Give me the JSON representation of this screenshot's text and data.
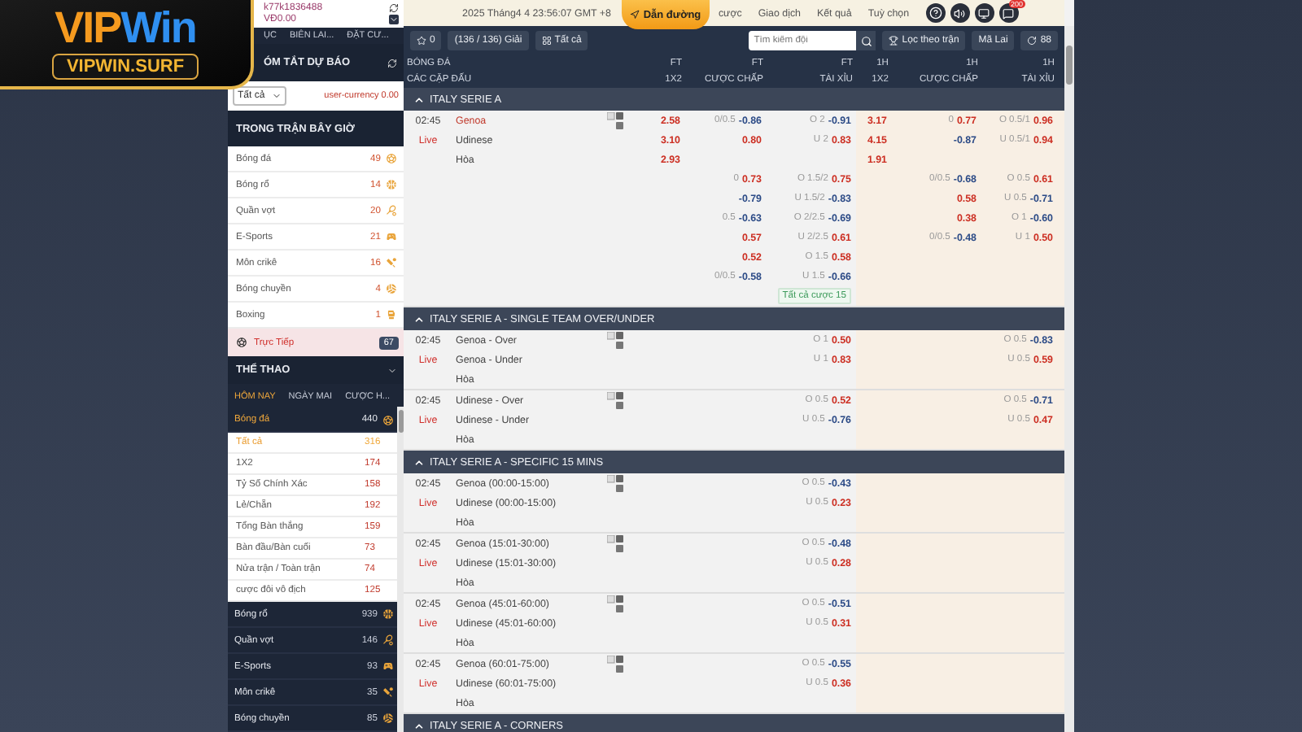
{
  "logo": {
    "wordmark": [
      "VIP",
      "Win"
    ],
    "domain": "VIPWIN.SURF"
  },
  "sidebar": {
    "account": {
      "username": "k77k1836488",
      "balance": "VĐ0.00"
    },
    "nav": [
      "ỤC",
      "BIÊN LAI...",
      "ĐẶT CƯ..."
    ],
    "summary": {
      "title": "ÓM TẮT DỰ BÁO",
      "filter": "Tất cả",
      "currency": "user-currency 0.00"
    },
    "in_play": {
      "title": "TRONG TRẬN BÂY GIỜ",
      "items": [
        {
          "name": "Bóng đá",
          "count": "49",
          "kind": "football"
        },
        {
          "name": "Bóng rổ",
          "count": "14",
          "kind": "basketball"
        },
        {
          "name": "Quần vợt",
          "count": "20",
          "kind": "tennis"
        },
        {
          "name": "E-Sports",
          "count": "21",
          "kind": "esports"
        },
        {
          "name": "Môn crikê",
          "count": "16",
          "kind": "cricket"
        },
        {
          "name": "Bóng chuyền",
          "count": "4",
          "kind": "volleyball"
        },
        {
          "name": "Boxing",
          "count": "1",
          "kind": "boxing"
        }
      ],
      "live": {
        "label": "Trực Tiếp",
        "count": "67"
      }
    },
    "sports": {
      "title": "THỂ THAO",
      "tabs": [
        {
          "label": "HÔM NAY",
          "selected": true
        },
        {
          "label": "NGÀY MAI",
          "selected": false
        },
        {
          "label": "CƯỢC H...",
          "selected": false
        }
      ],
      "featured": {
        "name": "Bóng đá",
        "count": "440",
        "kind": "football"
      },
      "markets": [
        {
          "name": "Tất cả",
          "count": "316",
          "selected": true
        },
        {
          "name": "1X2",
          "count": "174",
          "selected": false
        },
        {
          "name": "Tỷ Số Chính Xác",
          "count": "158",
          "selected": false
        },
        {
          "name": "Lẻ/Chẵn",
          "count": "192",
          "selected": false
        },
        {
          "name": "Tổng Bàn thắng",
          "count": "159",
          "selected": false
        },
        {
          "name": "Bàn đầu/Bàn cuối",
          "count": "73",
          "selected": false
        },
        {
          "name": "Nửa trận / Toàn trận",
          "count": "74",
          "selected": false
        },
        {
          "name": "cược đôi vô địch",
          "count": "125",
          "selected": false
        }
      ],
      "others": [
        {
          "name": "Bóng rổ",
          "count": "939",
          "kind": "basketball"
        },
        {
          "name": "Quần vợt",
          "count": "146",
          "kind": "tennis"
        },
        {
          "name": "E-Sports",
          "count": "93",
          "kind": "esports"
        },
        {
          "name": "Môn crikê",
          "count": "35",
          "kind": "cricket"
        },
        {
          "name": "Bóng chuyền",
          "count": "85",
          "kind": "volleyball"
        }
      ]
    }
  },
  "main": {
    "header": {
      "datetime": "2025 Tháng4 4 23:56:07 GMT +8",
      "guide": "Dẫn đường",
      "nav": [
        "cược",
        "Giao dịch",
        "Kết quả",
        "Tuỳ chọn"
      ],
      "badge": "200"
    },
    "toolbar": {
      "favorites": "0",
      "leagues": "(136 / 136) Giải",
      "all": "Tất cả",
      "search_placeholder": "Tìm kiếm đội",
      "filter": "Lọc theo trận",
      "odds_type": "Mã Lai",
      "refresh": "88"
    },
    "columns": [
      {
        "top": "BÓNG ĐÁ",
        "bottom": "CÁC CẶP ĐẤU"
      },
      {
        "top": "FT",
        "bottom": "1X2"
      },
      {
        "top": "FT",
        "bottom": "CƯỢC CHẤP"
      },
      {
        "top": "FT",
        "bottom": "TÀI XỈU"
      },
      {
        "top": "1H",
        "bottom": "1X2"
      },
      {
        "top": "1H",
        "bottom": "CƯỢC CHẤP"
      },
      {
        "top": "1H",
        "bottom": "TÀI XỈU"
      }
    ],
    "leagues": [
      {
        "name": "ITALY SERIE A",
        "expanded": true,
        "matches": [
          {
            "time": "02:45",
            "status": "Live",
            "more_bets": "Tất cả cược 15",
            "rows": [
              {
                "team": "Genoa",
                "favorite": true,
                "cells": [
                  {
                    "odds": "2.58",
                    "negative": false
                  },
                  {
                    "line": "0/0.5",
                    "odds": "-0.86",
                    "negative": true
                  },
                  {
                    "line": "O 2",
                    "odds": "-0.91",
                    "negative": true
                  },
                  {
                    "odds": "3.17",
                    "negative": false
                  },
                  {
                    "line": "0",
                    "odds": "0.77",
                    "negative": false
                  },
                  {
                    "line": "O 0.5/1",
                    "odds": "0.96",
                    "negative": false
                  }
                ]
              },
              {
                "team": "Udinese",
                "favorite": false,
                "cells": [
                  {
                    "odds": "3.10",
                    "negative": false
                  },
                  {
                    "odds": "0.80",
                    "negative": false
                  },
                  {
                    "line": "U 2",
                    "odds": "0.83",
                    "negative": false
                  },
                  {
                    "odds": "4.15",
                    "negative": false
                  },
                  {
                    "odds": "-0.87",
                    "negative": true
                  },
                  {
                    "line": "U 0.5/1",
                    "odds": "0.94",
                    "negative": false
                  }
                ]
              },
              {
                "team": "Hòa",
                "favorite": false,
                "cells": [
                  {
                    "odds": "2.93",
                    "negative": false
                  },
                  null,
                  null,
                  {
                    "odds": "1.91",
                    "negative": false
                  },
                  null,
                  null
                ]
              },
              {
                "cells": [
                  null,
                  {
                    "line": "0",
                    "odds": "0.73",
                    "negative": false
                  },
                  {
                    "line": "O 1.5/2",
                    "odds": "0.75",
                    "negative": false
                  },
                  null,
                  {
                    "line": "0/0.5",
                    "odds": "-0.68",
                    "negative": true
                  },
                  {
                    "line": "O 0.5",
                    "odds": "0.61",
                    "negative": false
                  }
                ]
              },
              {
                "cells": [
                  null,
                  {
                    "odds": "-0.79",
                    "negative": true
                  },
                  {
                    "line": "U 1.5/2",
                    "odds": "-0.83",
                    "negative": true
                  },
                  null,
                  {
                    "odds": "0.58",
                    "negative": false
                  },
                  {
                    "line": "U 0.5",
                    "odds": "-0.71",
                    "negative": true
                  }
                ]
              },
              {
                "cells": [
                  null,
                  {
                    "line": "0.5",
                    "odds": "-0.63",
                    "negative": true
                  },
                  {
                    "line": "O 2/2.5",
                    "odds": "-0.69",
                    "negative": true
                  },
                  null,
                  {
                    "odds": "0.38",
                    "negative": false
                  },
                  {
                    "line": "O 1",
                    "odds": "-0.60",
                    "negative": true
                  }
                ]
              },
              {
                "cells": [
                  null,
                  {
                    "odds": "0.57",
                    "negative": false
                  },
                  {
                    "line": "U 2/2.5",
                    "odds": "0.61",
                    "negative": false
                  },
                  null,
                  {
                    "line": "0/0.5",
                    "odds": "-0.48",
                    "negative": true
                  },
                  {
                    "line": "U 1",
                    "odds": "0.50",
                    "negative": false
                  }
                ]
              },
              {
                "cells": [
                  null,
                  {
                    "odds": "0.52",
                    "negative": false
                  },
                  {
                    "line": "O 1.5",
                    "odds": "0.58",
                    "negative": false
                  },
                  null,
                  null,
                  null
                ]
              },
              {
                "cells": [
                  null,
                  {
                    "line": "0/0.5",
                    "odds": "-0.58",
                    "negative": true
                  },
                  {
                    "line": "U 1.5",
                    "odds": "-0.66",
                    "negative": true
                  },
                  null,
                  null,
                  null
                ]
              }
            ]
          }
        ]
      },
      {
        "name": "ITALY SERIE A - SINGLE TEAM OVER/UNDER",
        "expanded": true,
        "matches": [
          {
            "time": "02:45",
            "status": "Live",
            "rows": [
              {
                "team": "Genoa - Over",
                "favorite": false,
                "cells": [
                  null,
                  null,
                  {
                    "line": "O 1",
                    "odds": "0.50",
                    "negative": false
                  },
                  null,
                  null,
                  {
                    "line": "O 0.5",
                    "odds": "-0.83",
                    "negative": true
                  }
                ]
              },
              {
                "team": "Genoa - Under",
                "favorite": false,
                "cells": [
                  null,
                  null,
                  {
                    "line": "U 1",
                    "odds": "0.83",
                    "negative": false
                  },
                  null,
                  null,
                  {
                    "line": "U 0.5",
                    "odds": "0.59",
                    "negative": false
                  }
                ]
              },
              {
                "team": "Hòa",
                "favorite": false,
                "cells": [
                  null,
                  null,
                  null,
                  null,
                  null,
                  null
                ]
              }
            ]
          },
          {
            "time": "02:45",
            "status": "Live",
            "rows": [
              {
                "team": "Udinese - Over",
                "favorite": false,
                "cells": [
                  null,
                  null,
                  {
                    "line": "O 0.5",
                    "odds": "0.52",
                    "negative": false
                  },
                  null,
                  null,
                  {
                    "line": "O 0.5",
                    "odds": "-0.71",
                    "negative": true
                  }
                ]
              },
              {
                "team": "Udinese - Under",
                "favorite": false,
                "cells": [
                  null,
                  null,
                  {
                    "line": "U 0.5",
                    "odds": "-0.76",
                    "negative": true
                  },
                  null,
                  null,
                  {
                    "line": "U 0.5",
                    "odds": "0.47",
                    "negative": false
                  }
                ]
              },
              {
                "team": "Hòa",
                "favorite": false,
                "cells": [
                  null,
                  null,
                  null,
                  null,
                  null,
                  null
                ]
              }
            ]
          }
        ]
      },
      {
        "name": "ITALY SERIE A - SPECIFIC 15 MINS",
        "expanded": true,
        "matches": [
          {
            "time": "02:45",
            "status": "Live",
            "rows": [
              {
                "team": "Genoa (00:00-15:00)",
                "favorite": false,
                "cells": [
                  null,
                  null,
                  {
                    "line": "O 0.5",
                    "odds": "-0.43",
                    "negative": true
                  },
                  null,
                  null,
                  null
                ]
              },
              {
                "team": "Udinese (00:00-15:00)",
                "favorite": false,
                "cells": [
                  null,
                  null,
                  {
                    "line": "U 0.5",
                    "odds": "0.23",
                    "negative": false
                  },
                  null,
                  null,
                  null
                ]
              },
              {
                "team": "Hòa",
                "favorite": false,
                "cells": [
                  null,
                  null,
                  null,
                  null,
                  null,
                  null
                ]
              }
            ]
          },
          {
            "time": "02:45",
            "status": "Live",
            "rows": [
              {
                "team": "Genoa (15:01-30:00)",
                "favorite": false,
                "cells": [
                  null,
                  null,
                  {
                    "line": "O 0.5",
                    "odds": "-0.48",
                    "negative": true
                  },
                  null,
                  null,
                  null
                ]
              },
              {
                "team": "Udinese (15:01-30:00)",
                "favorite": false,
                "cells": [
                  null,
                  null,
                  {
                    "line": "U 0.5",
                    "odds": "0.28",
                    "negative": false
                  },
                  null,
                  null,
                  null
                ]
              },
              {
                "team": "Hòa",
                "favorite": false,
                "cells": [
                  null,
                  null,
                  null,
                  null,
                  null,
                  null
                ]
              }
            ]
          },
          {
            "time": "02:45",
            "status": "Live",
            "rows": [
              {
                "team": "Genoa (45:01-60:00)",
                "favorite": false,
                "cells": [
                  null,
                  null,
                  {
                    "line": "O 0.5",
                    "odds": "-0.51",
                    "negative": true
                  },
                  null,
                  null,
                  null
                ]
              },
              {
                "team": "Udinese (45:01-60:00)",
                "favorite": false,
                "cells": [
                  null,
                  null,
                  {
                    "line": "U 0.5",
                    "odds": "0.31",
                    "negative": false
                  },
                  null,
                  null,
                  null
                ]
              },
              {
                "team": "Hòa",
                "favorite": false,
                "cells": [
                  null,
                  null,
                  null,
                  null,
                  null,
                  null
                ]
              }
            ]
          },
          {
            "time": "02:45",
            "status": "Live",
            "rows": [
              {
                "team": "Genoa (60:01-75:00)",
                "favorite": false,
                "cells": [
                  null,
                  null,
                  {
                    "line": "O 0.5",
                    "odds": "-0.55",
                    "negative": true
                  },
                  null,
                  null,
                  null
                ]
              },
              {
                "team": "Udinese (60:01-75:00)",
                "favorite": false,
                "cells": [
                  null,
                  null,
                  {
                    "line": "U 0.5",
                    "odds": "0.36",
                    "negative": false
                  },
                  null,
                  null,
                  null
                ]
              },
              {
                "team": "Hòa",
                "favorite": false,
                "cells": [
                  null,
                  null,
                  null,
                  null,
                  null,
                  null
                ]
              }
            ]
          }
        ]
      },
      {
        "name": "ITALY SERIE A - CORNERS",
        "expanded": true
      }
    ]
  }
}
